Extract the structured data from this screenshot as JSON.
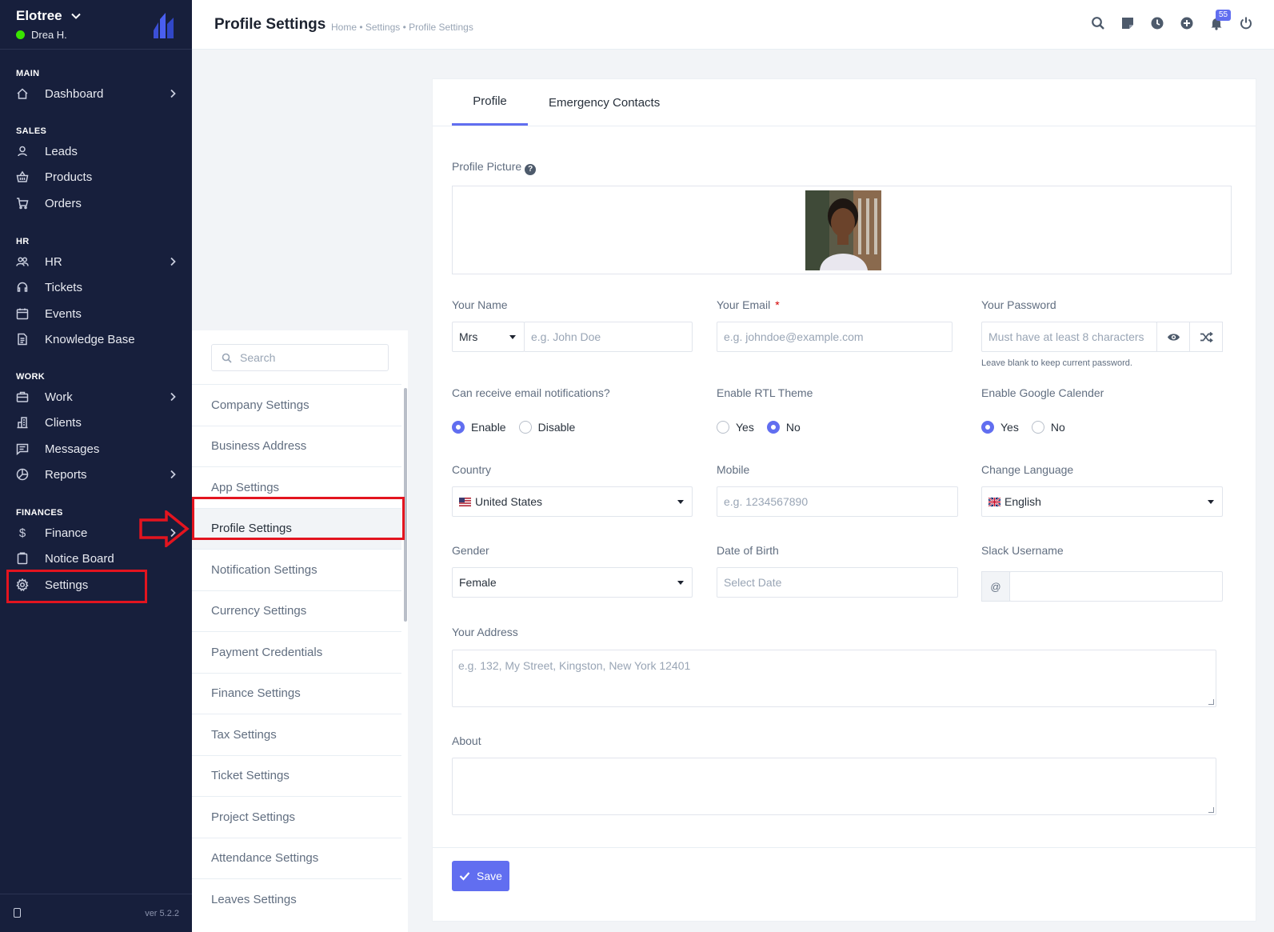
{
  "sidebar": {
    "company": "Elotree",
    "user": "Drea H.",
    "sections": {
      "main": "MAIN",
      "sales": "SALES",
      "hr": "HR",
      "work": "WORK",
      "finances": "FINANCES"
    },
    "items": {
      "dashboard": "Dashboard",
      "leads": "Leads",
      "products": "Products",
      "orders": "Orders",
      "hr": "HR",
      "tickets": "Tickets",
      "events": "Events",
      "knowledge_base": "Knowledge Base",
      "work": "Work",
      "clients": "Clients",
      "messages": "Messages",
      "reports": "Reports",
      "finance": "Finance",
      "notice_board": "Notice Board",
      "settings": "Settings"
    },
    "version": "ver 5.2.2"
  },
  "topbar": {
    "title": "Profile Settings",
    "breadcrumb": "Home • Settings • Profile Settings",
    "notification_count": "55"
  },
  "settings_menu": {
    "search_placeholder": "Search",
    "items": [
      "Company Settings",
      "Business Address",
      "App Settings",
      "Profile Settings",
      "Notification Settings",
      "Currency Settings",
      "Payment Credentials",
      "Finance Settings",
      "Tax Settings",
      "Ticket Settings",
      "Project Settings",
      "Attendance Settings",
      "Leaves Settings"
    ],
    "active": "Profile Settings"
  },
  "tabs": {
    "profile": "Profile",
    "emergency": "Emergency Contacts"
  },
  "form": {
    "profile_picture_label": "Profile Picture",
    "name_label": "Your Name",
    "salutation": "Mrs",
    "name_placeholder": "e.g. John Doe",
    "email_label": "Your Email",
    "email_required": "*",
    "email_placeholder": "e.g. johndoe@example.com",
    "password_label": "Your Password",
    "password_placeholder": "Must have at least 8 characters",
    "password_help": "Leave blank to keep current password.",
    "email_notif_label": "Can receive email notifications?",
    "email_notif_enable": "Enable",
    "email_notif_disable": "Disable",
    "rtl_label": "Enable RTL Theme",
    "rtl_yes": "Yes",
    "rtl_no": "No",
    "gcal_label": "Enable Google Calender",
    "gcal_yes": "Yes",
    "gcal_no": "No",
    "country_label": "Country",
    "country_value": "United States",
    "mobile_label": "Mobile",
    "mobile_placeholder": "e.g. 1234567890",
    "language_label": "Change Language",
    "language_value": "English",
    "gender_label": "Gender",
    "gender_value": "Female",
    "dob_label": "Date of Birth",
    "dob_placeholder": "Select Date",
    "slack_label": "Slack Username",
    "slack_prefix": "@",
    "address_label": "Your Address",
    "address_placeholder": "e.g. 132, My Street, Kingston, New York 12401",
    "about_label": "About",
    "save_label": "Save"
  },
  "colors": {
    "sidebar_bg": "#171f3c",
    "accent": "#616ef0",
    "annotation": "#e3141f",
    "online": "#39e500"
  }
}
